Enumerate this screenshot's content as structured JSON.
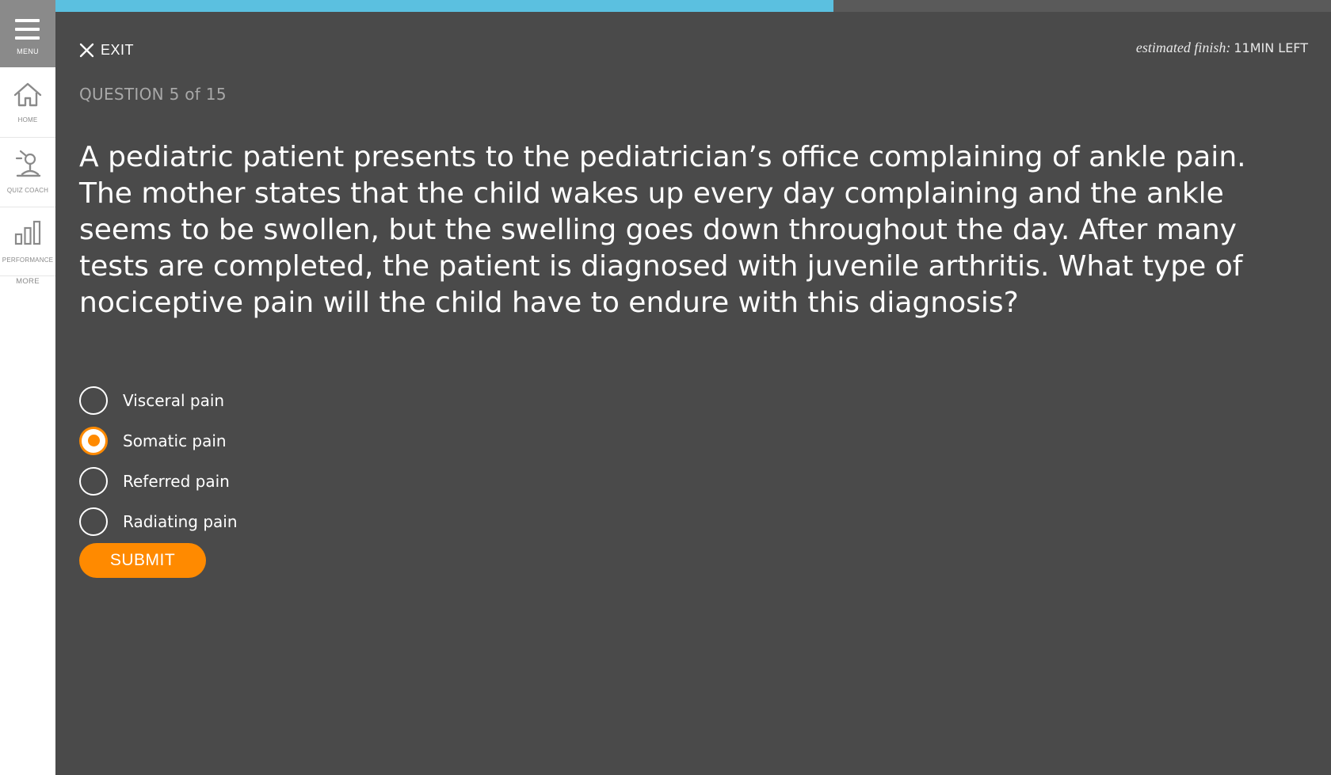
{
  "sidebar": {
    "menu_label": "MENU",
    "items": [
      {
        "label": "HOME",
        "icon": "home-icon"
      },
      {
        "label": "QUIZ COACH",
        "icon": "quiz-coach-icon"
      },
      {
        "label": "PERFORMANCE",
        "icon": "performance-icon"
      }
    ],
    "more_label": "MORE"
  },
  "progress": {
    "fraction": 0.61,
    "color": "#5bc0e0"
  },
  "header": {
    "exit_label": "EXIT",
    "estimated_label": "estimated finish:",
    "time_left": "11MIN LEFT"
  },
  "question": {
    "counter": "QUESTION 5 of 15",
    "text": "A pediatric patient presents to the pediatrician’s office complaining of ankle pain. The mother states that the child wakes up every day complaining and the ankle seems to be swollen, but the swelling goes down throughout the day. After many tests are completed, the patient is diagnosed with juvenile arthritis. What type of nociceptive pain will the child have to endure with this diagnosis?"
  },
  "options": [
    {
      "label": "Visceral pain",
      "selected": false
    },
    {
      "label": "Somatic pain",
      "selected": true
    },
    {
      "label": "Referred pain",
      "selected": false
    },
    {
      "label": "Radiating pain",
      "selected": false
    }
  ],
  "submit_label": "SUBMIT",
  "colors": {
    "background": "#4a4a4a",
    "accent": "#ff8a00",
    "progress": "#5bc0e0",
    "sidebar": "#ffffff",
    "menu": "#8a8a8a"
  }
}
